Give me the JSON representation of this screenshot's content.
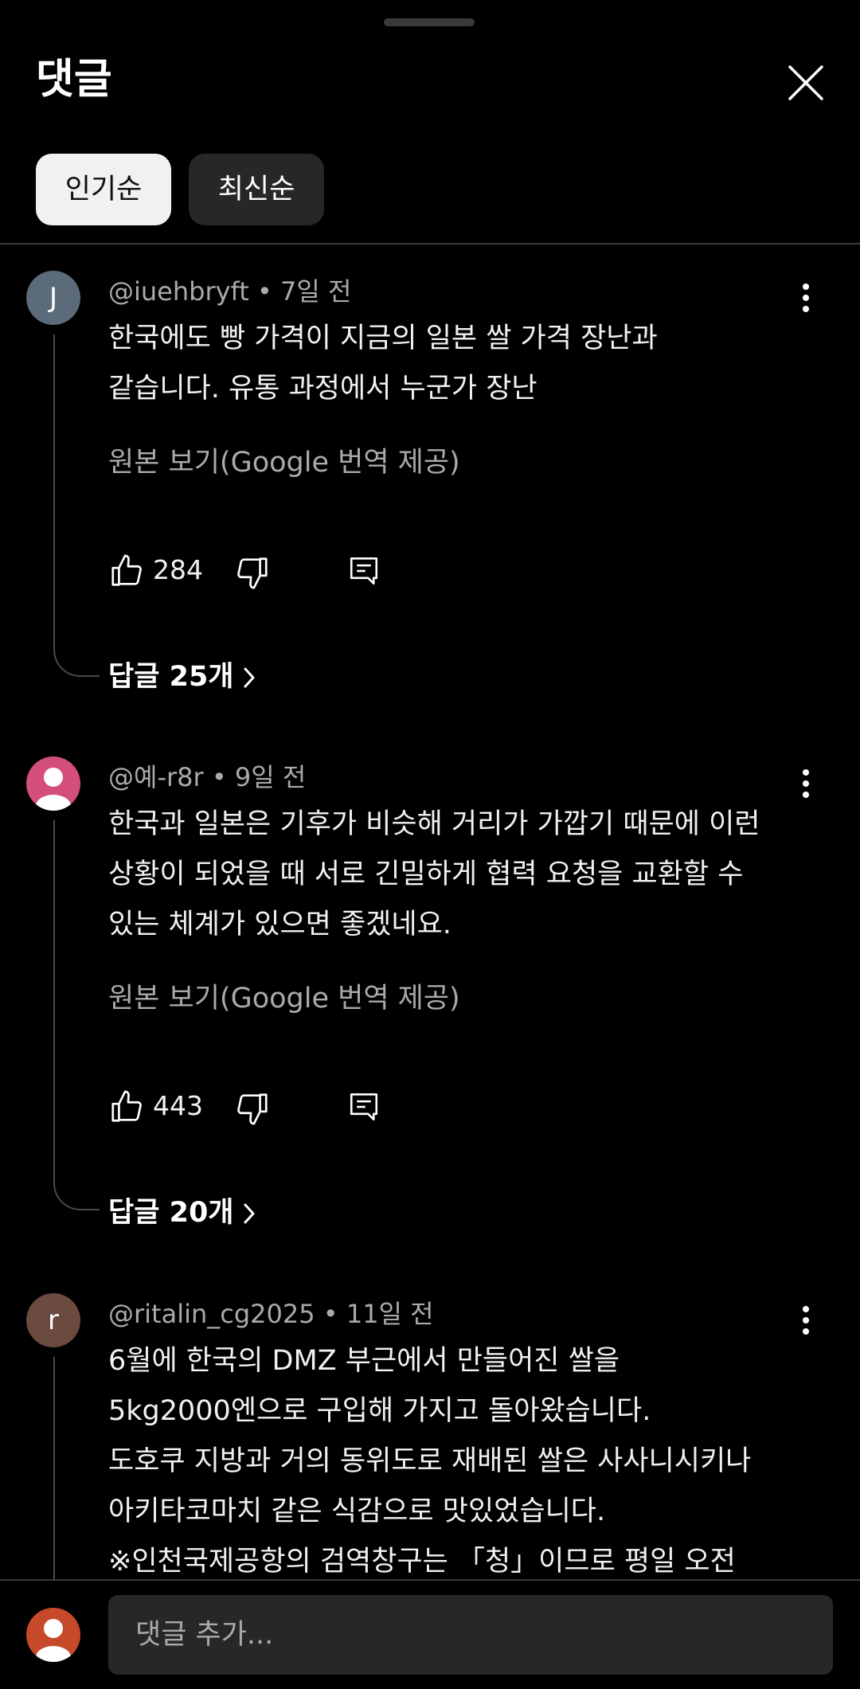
{
  "header": {
    "title": "댓글"
  },
  "sort_chips": [
    {
      "label": "인기순",
      "selected": true
    },
    {
      "label": "최신순",
      "selected": false
    }
  ],
  "comments": [
    {
      "avatar_letter": "J",
      "avatar_color": "#5b6b7a",
      "author": "@iuehbryft",
      "time": "7일 전",
      "text_lines": [
        "한국에도 빵 가격이 지금의 일본 쌀 가격 장난과",
        "같습니다. 유통 과정에서 누군가 장난"
      ],
      "translate_label": "원본 보기(Google 번역 제공)",
      "likes": "284",
      "replies_label": "답글 25개"
    },
    {
      "avatar_letter": "",
      "avatar_color": "#d34f7a",
      "author": "@예-r8r",
      "time": "9일 전",
      "text_lines": [
        "한국과 일본은 기후가 비슷해 거리가 가깝기 때문에 이런",
        "상황이 되었을 때 서로 긴밀하게 협력 요청을 교환할 수",
        "있는 체계가 있으면 좋겠네요."
      ],
      "translate_label": "원본 보기(Google 번역 제공)",
      "likes": "443",
      "replies_label": "답글 20개"
    },
    {
      "avatar_letter": "r",
      "avatar_color": "#6b4a3f",
      "author": "@ritalin_cg2025",
      "time": "11일 전",
      "text_lines": [
        "6월에 한국의 DMZ 부근에서 만들어진 쌀을",
        "5kg2000엔으로 구입해 가지고 돌아왔습니다.",
        "도호쿠 지방과 거의 동위도로 재배된 쌀은 사사니시키나",
        "아키타코마치 같은 식감으로 맛있었습니다.",
        "※인천국제공항의 검역창구는 「청」이므로 평일 오전"
      ]
    }
  ],
  "composer": {
    "placeholder": "댓글 추가..."
  },
  "colors": {
    "background": "#000000",
    "chip_selected": "#f1f1f1",
    "chip_unselected": "#272727",
    "secondary_text": "#aaaaaa"
  }
}
